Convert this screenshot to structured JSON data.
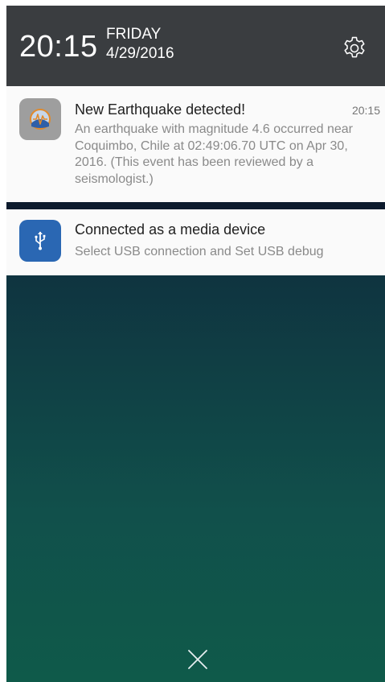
{
  "status_header": {
    "time": "20:15",
    "weekday": "FRIDAY",
    "date": "4/29/2016",
    "settings_icon": "gear-icon"
  },
  "notifications": [
    {
      "app_icon": "earthquake-app-icon",
      "title": "New Earthquake detected!",
      "time": "20:15",
      "body": "An earthquake with magnitude 4.6 occurred near Coquimbo, Chile at 02:49:06.70 UTC on Apr 30, 2016. (This event has been reviewed by a seismologist.)"
    },
    {
      "app_icon": "usb-icon",
      "title": "Connected as a media device",
      "body": "Select USB connection and Set USB debug"
    }
  ],
  "dismiss_icon": "close-icon",
  "colors": {
    "header_bg": "#3a3d40",
    "usb_icon_bg": "#2a67b3",
    "earthquake_icon_bg": "#9e9e9e"
  }
}
